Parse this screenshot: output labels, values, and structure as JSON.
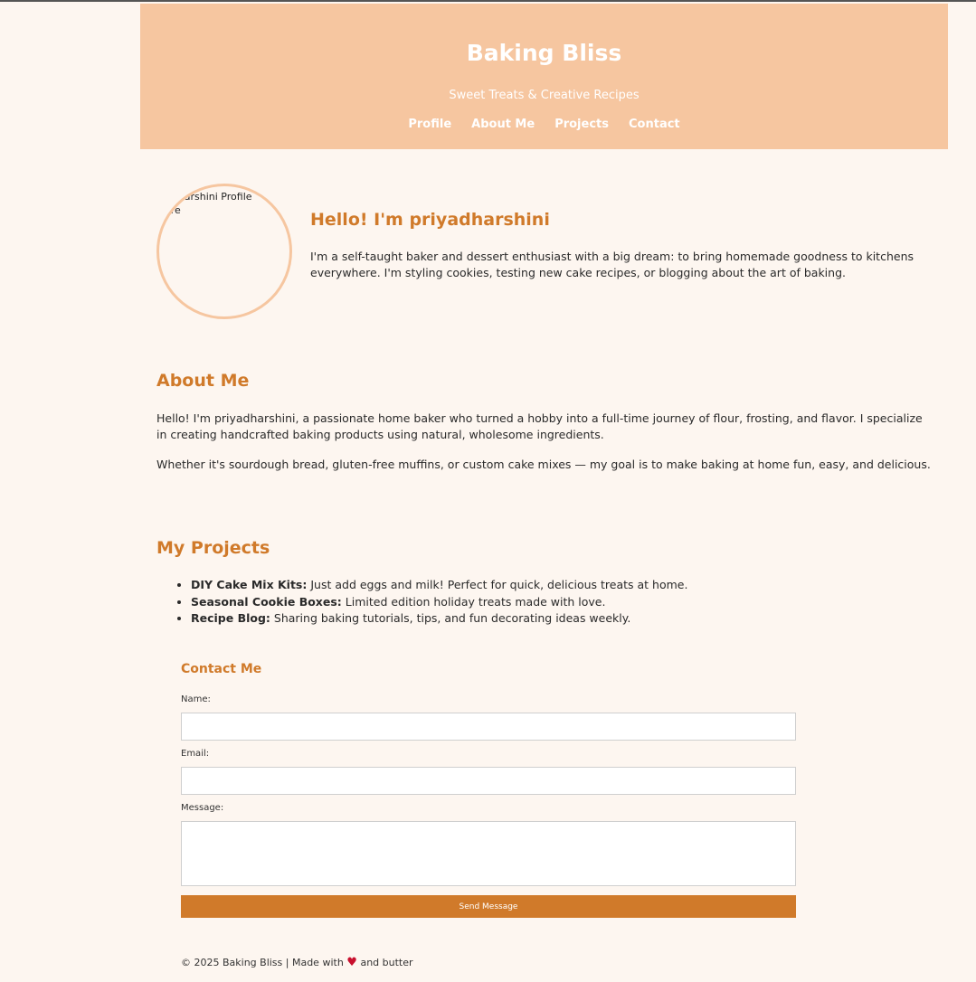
{
  "header": {
    "title": "Baking Bliss",
    "tagline": "Sweet Treats & Creative Recipes",
    "nav": [
      "Profile",
      "About Me",
      "Projects",
      "Contact"
    ]
  },
  "profile": {
    "avatar_alt": "priyadharshini Profile Picture",
    "greeting": "Hello! I'm priyadharshini",
    "intro": "I'm a self-taught baker and dessert enthusiast with a big dream: to bring homemade goodness to kitchens everywhere. I'm styling cookies, testing new cake recipes, or blogging about the art of baking."
  },
  "about": {
    "title": "About Me",
    "p1": "Hello! I'm priyadharshini, a passionate home baker who turned a hobby into a full-time journey of flour, frosting, and flavor. I specialize in creating handcrafted baking products using natural, wholesome ingredients.",
    "p2": "Whether it's sourdough bread, gluten-free muffins, or custom cake mixes — my goal is to make baking at home fun, easy, and delicious."
  },
  "projects": {
    "title": "My Projects",
    "items": [
      {
        "name": "DIY Cake Mix Kits:",
        "desc": " Just add eggs and milk! Perfect for quick, delicious treats at home."
      },
      {
        "name": "Seasonal Cookie Boxes:",
        "desc": " Limited edition holiday treats made with love."
      },
      {
        "name": "Recipe Blog:",
        "desc": " Sharing baking tutorials, tips, and fun decorating ideas weekly."
      }
    ]
  },
  "contact": {
    "title": "Contact Me",
    "name_label": "Name:",
    "email_label": "Email:",
    "message_label": "Message:",
    "send_label": "Send Message"
  },
  "footer": {
    "prefix": "© 2025 Baking Bliss | Made with",
    "heart": "♥",
    "suffix": "and butter",
    "heart_color": "#c8102e"
  },
  "colors": {
    "header_bg": "#f6c6a0",
    "accent": "#d07a2a",
    "page_bg": "#fdf6f0"
  }
}
